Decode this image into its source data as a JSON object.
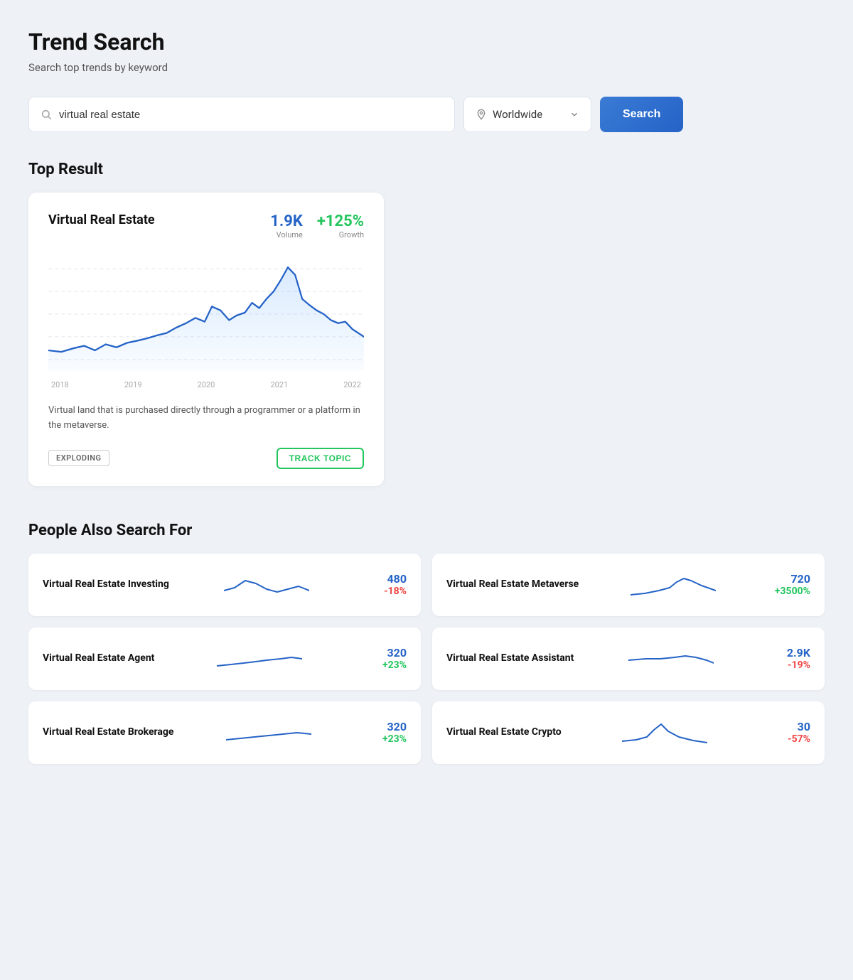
{
  "page": {
    "title": "Trend Search",
    "subtitle": "Search top trends by keyword"
  },
  "search": {
    "input_value": "virtual real estate",
    "input_placeholder": "virtual real estate",
    "location_label": "Worldwide",
    "button_label": "Search"
  },
  "top_result": {
    "section_title": "Top Result",
    "card": {
      "title": "Virtual Real Estate",
      "volume": "1.9K",
      "volume_label": "Volume",
      "growth": "+125%",
      "growth_label": "Growth",
      "description": "Virtual land that is purchased directly through a programmer or a platform in the metaverse.",
      "badge": "EXPLODING",
      "track_btn": "TRACK TOPIC",
      "x_labels": [
        "2018",
        "2019",
        "2020",
        "2021",
        "2022"
      ]
    }
  },
  "people_also": {
    "section_title": "People Also Search For",
    "items": [
      {
        "title": "Virtual Real Estate Investing",
        "volume": "480",
        "growth": "-18%",
        "growth_positive": false
      },
      {
        "title": "Virtual Real Estate Metaverse",
        "volume": "720",
        "growth": "+3500%",
        "growth_positive": true
      },
      {
        "title": "Virtual Real Estate Agent",
        "volume": "320",
        "growth": "+23%",
        "growth_positive": true
      },
      {
        "title": "Virtual Real Estate Assistant",
        "volume": "2.9K",
        "growth": "-19%",
        "growth_positive": false
      },
      {
        "title": "Virtual Real Estate Brokerage",
        "volume": "320",
        "growth": "+23%",
        "growth_positive": true
      },
      {
        "title": "Virtual Real Estate Crypto",
        "volume": "30",
        "growth": "-57%",
        "growth_positive": false
      }
    ]
  },
  "icons": {
    "search": "🔍",
    "location": "📍",
    "chevron_down": "▾"
  }
}
